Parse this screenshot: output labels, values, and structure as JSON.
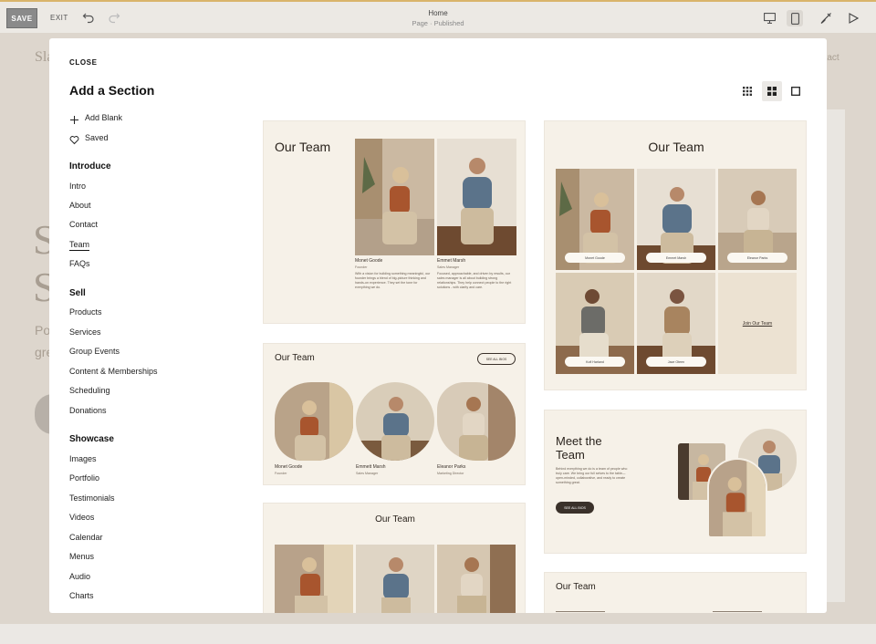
{
  "topbar": {
    "save_label": "SAVE",
    "exit_label": "EXIT",
    "page_title": "Home",
    "page_status": "Page · Published"
  },
  "background": {
    "slogan_fragment": "Sla",
    "nav_fragment": "ntact",
    "heading_fragment_1": "S",
    "heading_fragment_2": "S",
    "body_fragment_1": "Po",
    "body_fragment_2": "gre"
  },
  "modal": {
    "close_label": "CLOSE",
    "title": "Add a Section",
    "quick_actions": [
      {
        "label": "Add Blank",
        "icon": "plus-icon"
      },
      {
        "label": "Saved",
        "icon": "heart-icon"
      }
    ],
    "categories": [
      {
        "name": "Introduce",
        "items": [
          "Intro",
          "About",
          "Contact",
          "Team",
          "FAQs"
        ]
      },
      {
        "name": "Sell",
        "items": [
          "Products",
          "Services",
          "Group Events",
          "Content & Memberships",
          "Scheduling",
          "Donations"
        ]
      },
      {
        "name": "Showcase",
        "items": [
          "Images",
          "Portfolio",
          "Testimonials",
          "Videos",
          "Calendar",
          "Menus",
          "Audio",
          "Charts"
        ]
      }
    ],
    "active_item": "Team",
    "view_modes": [
      "grid-small-icon",
      "grid-large-icon",
      "single-icon"
    ],
    "active_view": "grid-large-icon"
  },
  "cards": {
    "card1": {
      "title": "Our Team",
      "members": [
        {
          "name": "Monet Goode",
          "role": "Founder",
          "bio": "With a vision for building something meaningful, our founder brings a blend of big-picture thinking and hands-on experience. They set the tone for everything we do."
        },
        {
          "name": "Emmet Marsh",
          "role": "Sales Manager",
          "bio": "Focused, approachable, and driven by results, our sales manager is all about building strong relationships. They help connect people to the right solutions - with clarity and care."
        }
      ]
    },
    "card2": {
      "title": "Our Team",
      "button": "SEE ALL BIOS",
      "members": [
        {
          "name": "Monet Goode",
          "role": "Founder"
        },
        {
          "name": "Emmett Marsh",
          "role": "Sales Manager"
        },
        {
          "name": "Eleanor Parks",
          "role": "Marketing Director"
        }
      ]
    },
    "card3": {
      "title": "Our Team"
    },
    "card4": {
      "title": "Our Team",
      "labels": [
        "Monet Goode",
        "Emmet Marsh",
        "Eleanor Parks",
        "Kofi Harland",
        "Jace Oteen"
      ],
      "join_link": "Join Our Team"
    },
    "card5": {
      "title_line1": "Meet the",
      "title_line2": "Team",
      "body": "Behind everything we do is a team of people who truly care. We bring our full selves to the table— open-minded, collaborative, and ready to create something great.",
      "button": "SEE ALL BIOS"
    },
    "card6": {
      "title": "Our Team"
    }
  },
  "colors": {
    "card_bg": "#f6f1e8",
    "accent_topbar": "#d9b46a",
    "dark_text": "#2a231d"
  }
}
